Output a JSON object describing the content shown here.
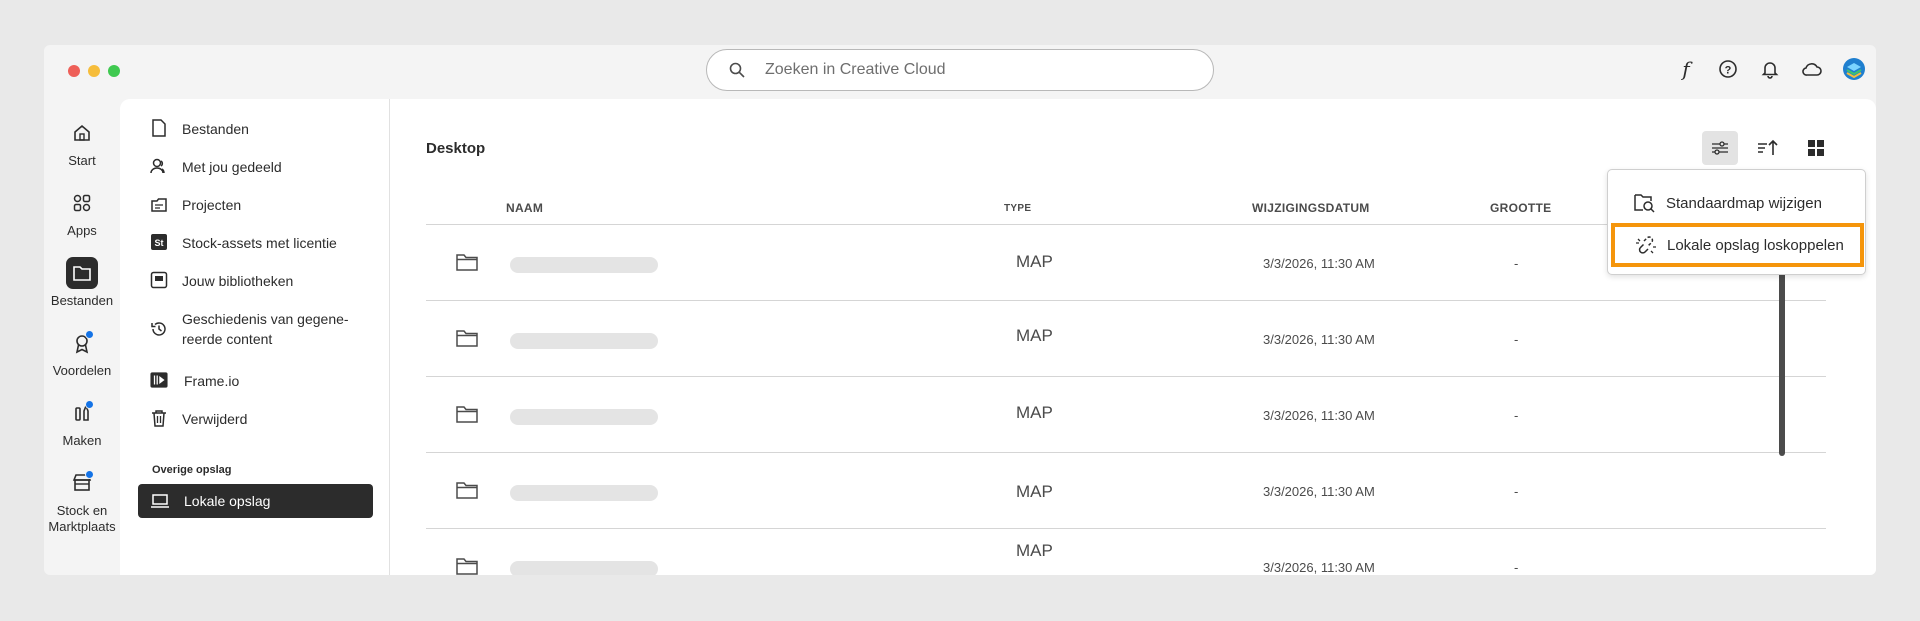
{
  "window": {
    "traffic_lights": [
      "#ee5f58",
      "#f6bd3b",
      "#3fc950"
    ]
  },
  "search": {
    "placeholder": "Zoeken in Creative Cloud"
  },
  "top_icons": [
    "fonts-icon",
    "help-icon",
    "bell-icon",
    "cloud-icon",
    "avatar"
  ],
  "rail": [
    {
      "label": "Start",
      "icon": "home-icon",
      "active": false,
      "badge": false
    },
    {
      "label": "Apps",
      "icon": "apps-icon",
      "active": false,
      "badge": false
    },
    {
      "label": "Bestanden",
      "icon": "folder-icon",
      "active": true,
      "badge": false
    },
    {
      "label": "Voordelen",
      "icon": "ribbon-icon",
      "active": false,
      "badge": true
    },
    {
      "label": "Maken",
      "icon": "create-icon",
      "active": false,
      "badge": true
    },
    {
      "label": "Stock en Marktplaats",
      "icon": "store-icon",
      "active": false,
      "badge": true
    }
  ],
  "sidebar": {
    "items": [
      {
        "label": "Bestanden",
        "icon": "file-icon"
      },
      {
        "label": "Met jou gedeeld",
        "icon": "shared-icon"
      },
      {
        "label": "Projecten",
        "icon": "projects-icon"
      },
      {
        "label": "Stock-assets met licentie",
        "icon": "stock-icon"
      },
      {
        "label": "Jouw bibliotheken",
        "icon": "library-icon"
      },
      {
        "label": "Geschiedenis van gegene-",
        "label2": "reerde content",
        "icon": "history-icon"
      },
      {
        "label": "Frame.io",
        "icon": "frameio-icon"
      },
      {
        "label": "Verwijderd",
        "icon": "trash-icon"
      }
    ],
    "heading": "Overige opslag",
    "active_item": {
      "label": "Lokale opslag",
      "icon": "laptop-icon"
    }
  },
  "content": {
    "breadcrumb": "Desktop",
    "columns": {
      "name": "NAAM",
      "type": "TYPE",
      "date": "WIJZIGINGSDATUM",
      "size": "GROOTTE"
    },
    "rows": [
      {
        "type": "MAP",
        "date": "3/3/2026, 11:30 AM",
        "size": "-"
      },
      {
        "type": "MAP",
        "date": "3/3/2026, 11:30 AM",
        "size": "-"
      },
      {
        "type": "MAP",
        "date": "3/3/2026, 11:30 AM",
        "size": "-"
      },
      {
        "type": "MAP",
        "date": "3/3/2026, 11:30 AM",
        "size": "-"
      },
      {
        "type": "MAP",
        "date": "3/3/2026, 11:30 AM",
        "size": "-"
      }
    ]
  },
  "menu": {
    "items": [
      {
        "label": "Standaardmap wijzigen",
        "icon": "folder-search-icon"
      },
      {
        "label": "Lokale opslag loskoppelen",
        "icon": "unlink-icon",
        "highlight": "#f5950b"
      }
    ]
  }
}
